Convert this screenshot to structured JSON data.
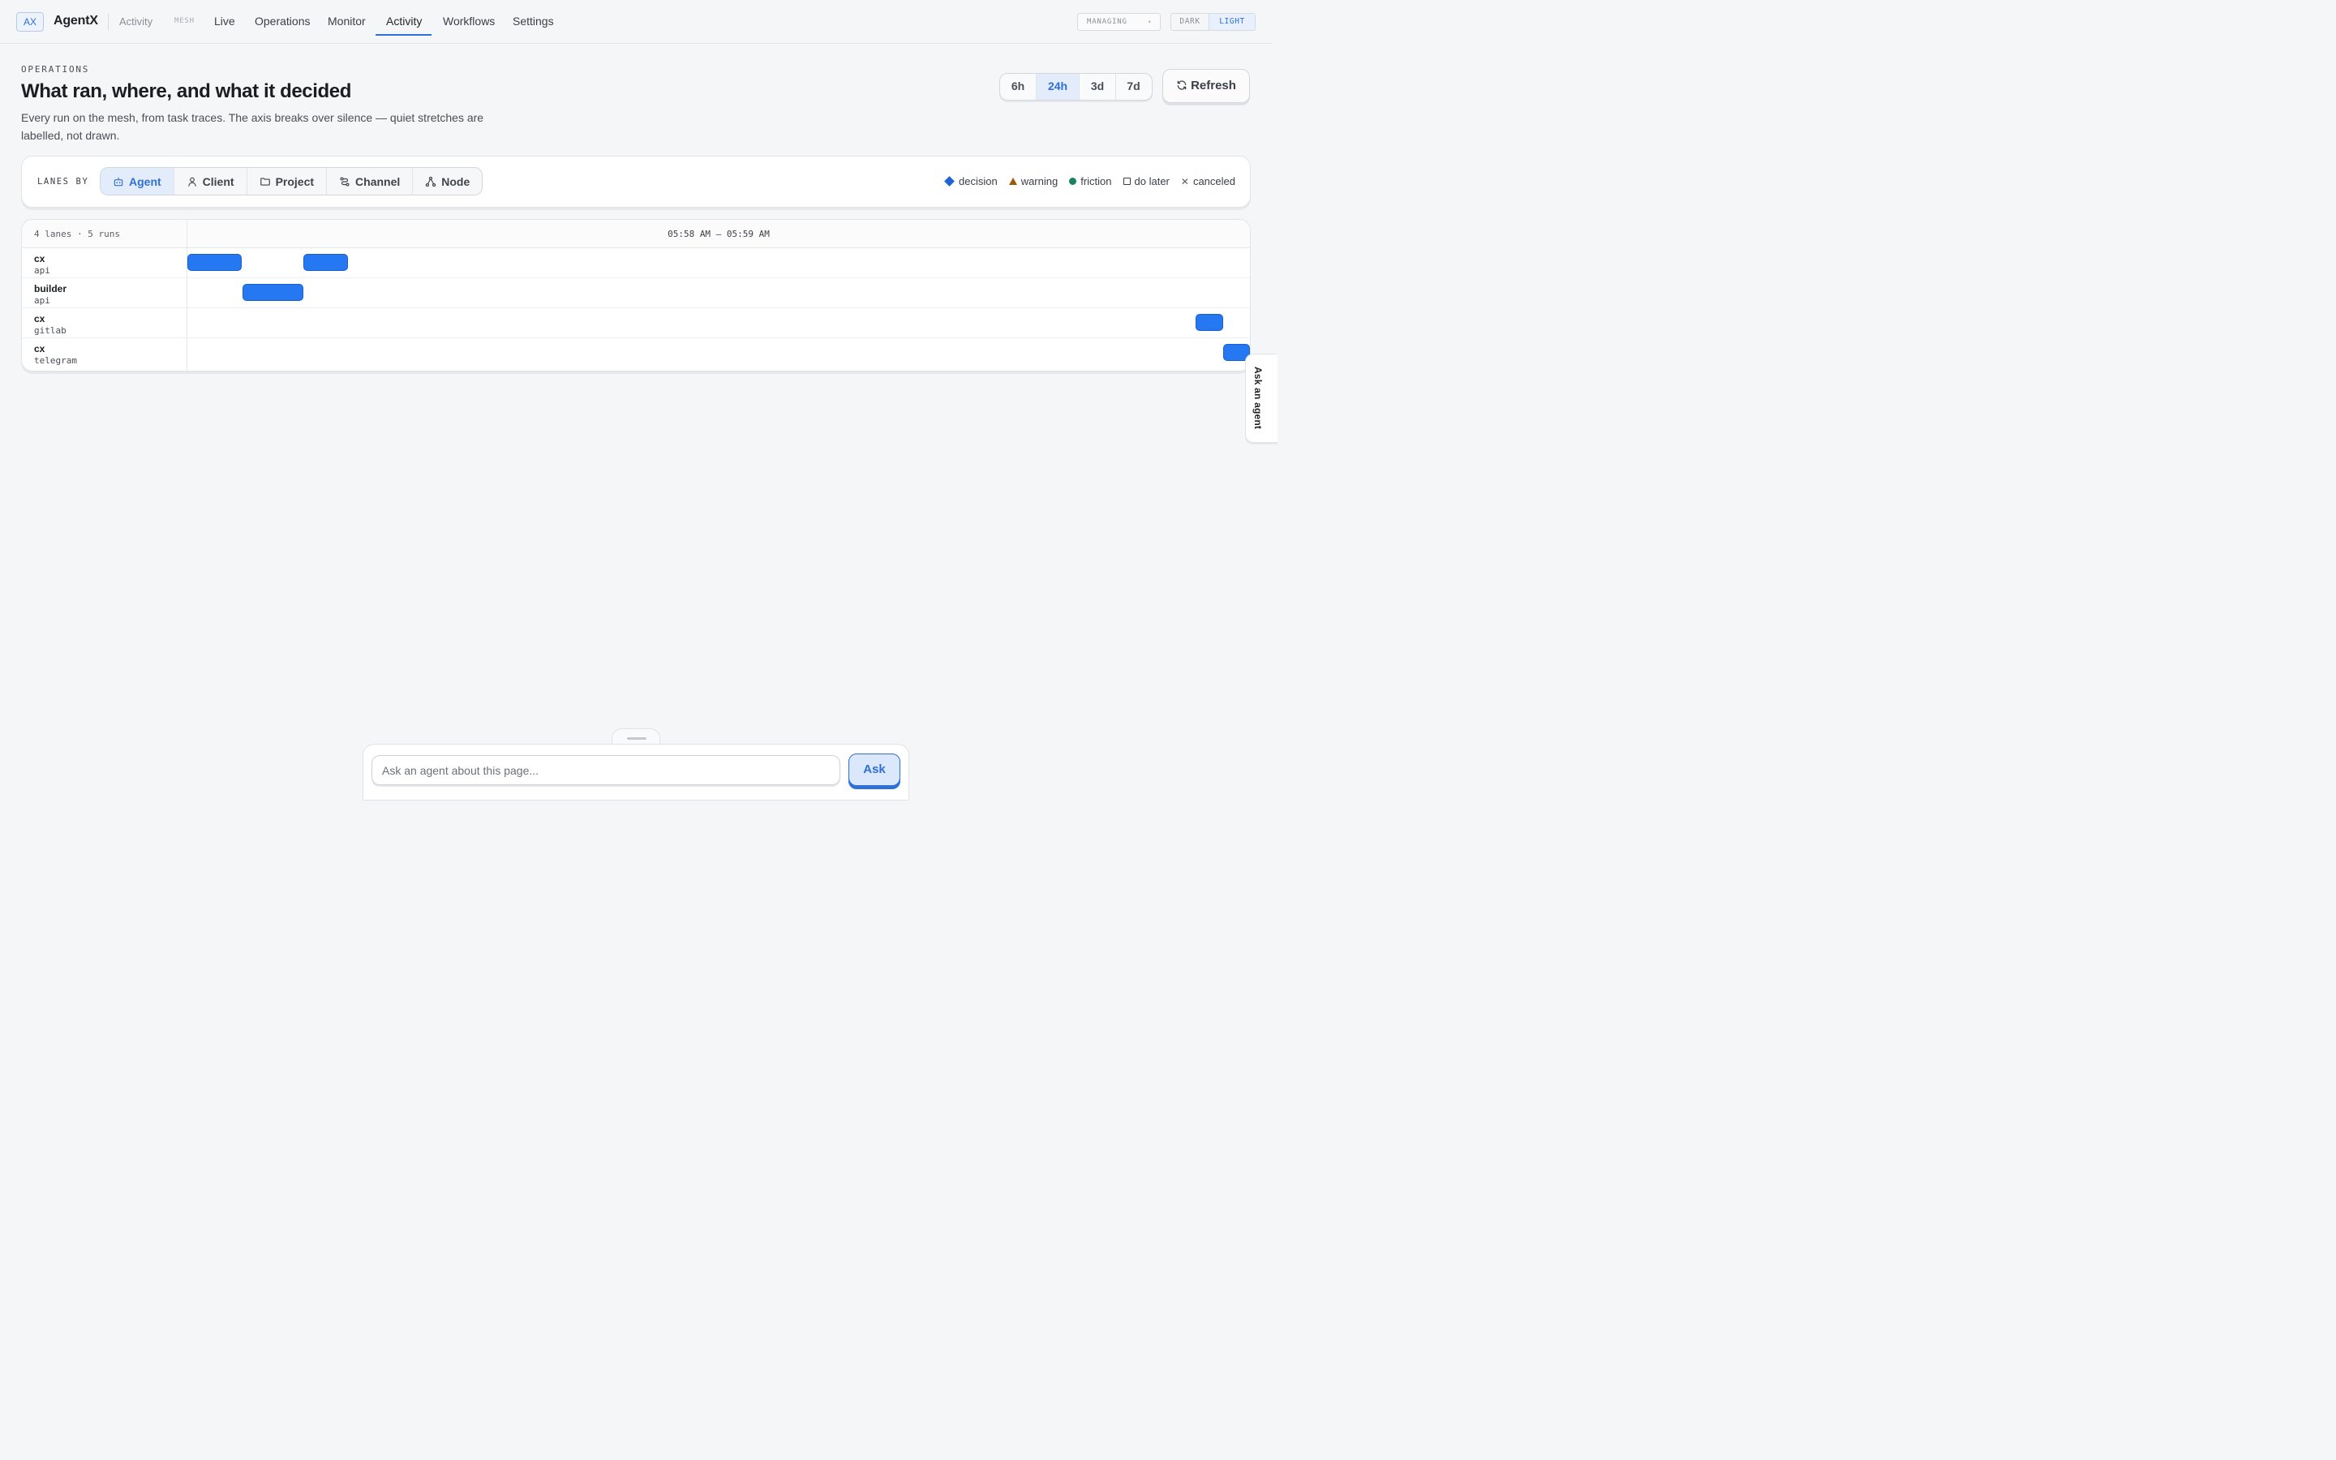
{
  "nav": {
    "brand_mark": "AX",
    "brand_name": "AgentX",
    "brand_sub": "Activity",
    "mesh_tag": "MESH",
    "links": [
      "Live",
      "Operations",
      "Monitor",
      "Activity",
      "Workflows",
      "Settings"
    ],
    "active_link": "Activity",
    "managing_label": "MANAGING",
    "theme": {
      "dark": "DARK",
      "light": "LIGHT",
      "selected": "LIGHT"
    }
  },
  "header": {
    "eyebrow": "OPERATIONS",
    "title": "What ran, where, and what it decided",
    "description": "Every run on the mesh, from task traces. The axis breaks over silence — quiet stretches are labelled, not drawn.",
    "ranges": [
      "6h",
      "24h",
      "3d",
      "7d"
    ],
    "selected_range": "24h",
    "refresh_label": "Refresh"
  },
  "lanes_by": {
    "label": "LANES BY",
    "options": [
      {
        "label": "Agent",
        "icon": "bot-icon"
      },
      {
        "label": "Client",
        "icon": "user-icon"
      },
      {
        "label": "Project",
        "icon": "folder-icon"
      },
      {
        "label": "Channel",
        "icon": "route-icon"
      },
      {
        "label": "Node",
        "icon": "network-icon"
      }
    ],
    "selected": "Agent"
  },
  "legend": [
    {
      "label": "decision",
      "icon": "diamond",
      "color": "#1f63d6"
    },
    {
      "label": "warning",
      "icon": "triangle",
      "color": "#9a5a06"
    },
    {
      "label": "friction",
      "icon": "dot",
      "color": "#17845e"
    },
    {
      "label": "do later",
      "icon": "square",
      "color": "#3b4048"
    },
    {
      "label": "canceled",
      "icon": "x",
      "color": "#5a5f66"
    }
  ],
  "timeline": {
    "summary": "4 lanes · 5 runs",
    "range_label": "05:58 AM – 05:59 AM",
    "run_color": "#2577f2",
    "lanes": [
      {
        "agent": "cx",
        "channel": "api",
        "runs": [
          {
            "start": 0.0,
            "end": 0.051
          },
          {
            "start": 0.109,
            "end": 0.151
          }
        ]
      },
      {
        "agent": "builder",
        "channel": "api",
        "runs": [
          {
            "start": 0.052,
            "end": 0.109
          }
        ]
      },
      {
        "agent": "cx",
        "channel": "gitlab",
        "runs": [
          {
            "start": 0.949,
            "end": 0.975
          }
        ]
      },
      {
        "agent": "cx",
        "channel": "telegram",
        "runs": [
          {
            "start": 0.975,
            "end": 1.0
          }
        ]
      }
    ]
  },
  "side_tab": {
    "label": "Ask an agent"
  },
  "ask_bar": {
    "placeholder": "Ask an agent about this page...",
    "value": "",
    "button_label": "Ask"
  }
}
